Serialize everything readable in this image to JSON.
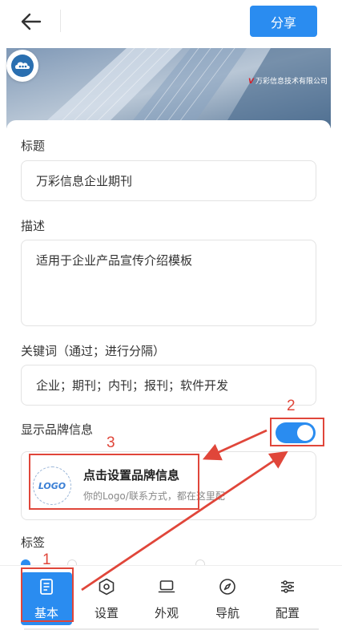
{
  "topbar": {
    "share_label": "分享"
  },
  "banner": {
    "company_text": "万彩信息技术有限公司",
    "mark": "V"
  },
  "form": {
    "title_label": "标题",
    "title_value": "万彩信息企业期刊",
    "desc_label": "描述",
    "desc_value": "适用于企业产品宣传介绍模板",
    "keywords_label": "关键词（通过；进行分隔）",
    "keywords_value": "企业；期刊；内刊；报刊；软件开发",
    "brand_toggle_label": "显示品牌信息",
    "brand_toggle_on": true,
    "tags_label": "标签"
  },
  "brand_card": {
    "logo_text": "LOGO",
    "title": "点击设置品牌信息",
    "subtitle": "你的Logo/联系方式，都在这里配"
  },
  "tabs": [
    {
      "label": "基本",
      "icon": "document-icon",
      "active": true
    },
    {
      "label": "设置",
      "icon": "hexagon-settings-icon",
      "active": false
    },
    {
      "label": "外观",
      "icon": "laptop-icon",
      "active": false
    },
    {
      "label": "导航",
      "icon": "compass-icon",
      "active": false
    },
    {
      "label": "配置",
      "icon": "sliders-icon",
      "active": false
    }
  ],
  "annotations": {
    "n1": "1",
    "n2": "2",
    "n3": "3"
  },
  "colors": {
    "accent": "#2a8cf0",
    "annotation": "#e0463a"
  }
}
